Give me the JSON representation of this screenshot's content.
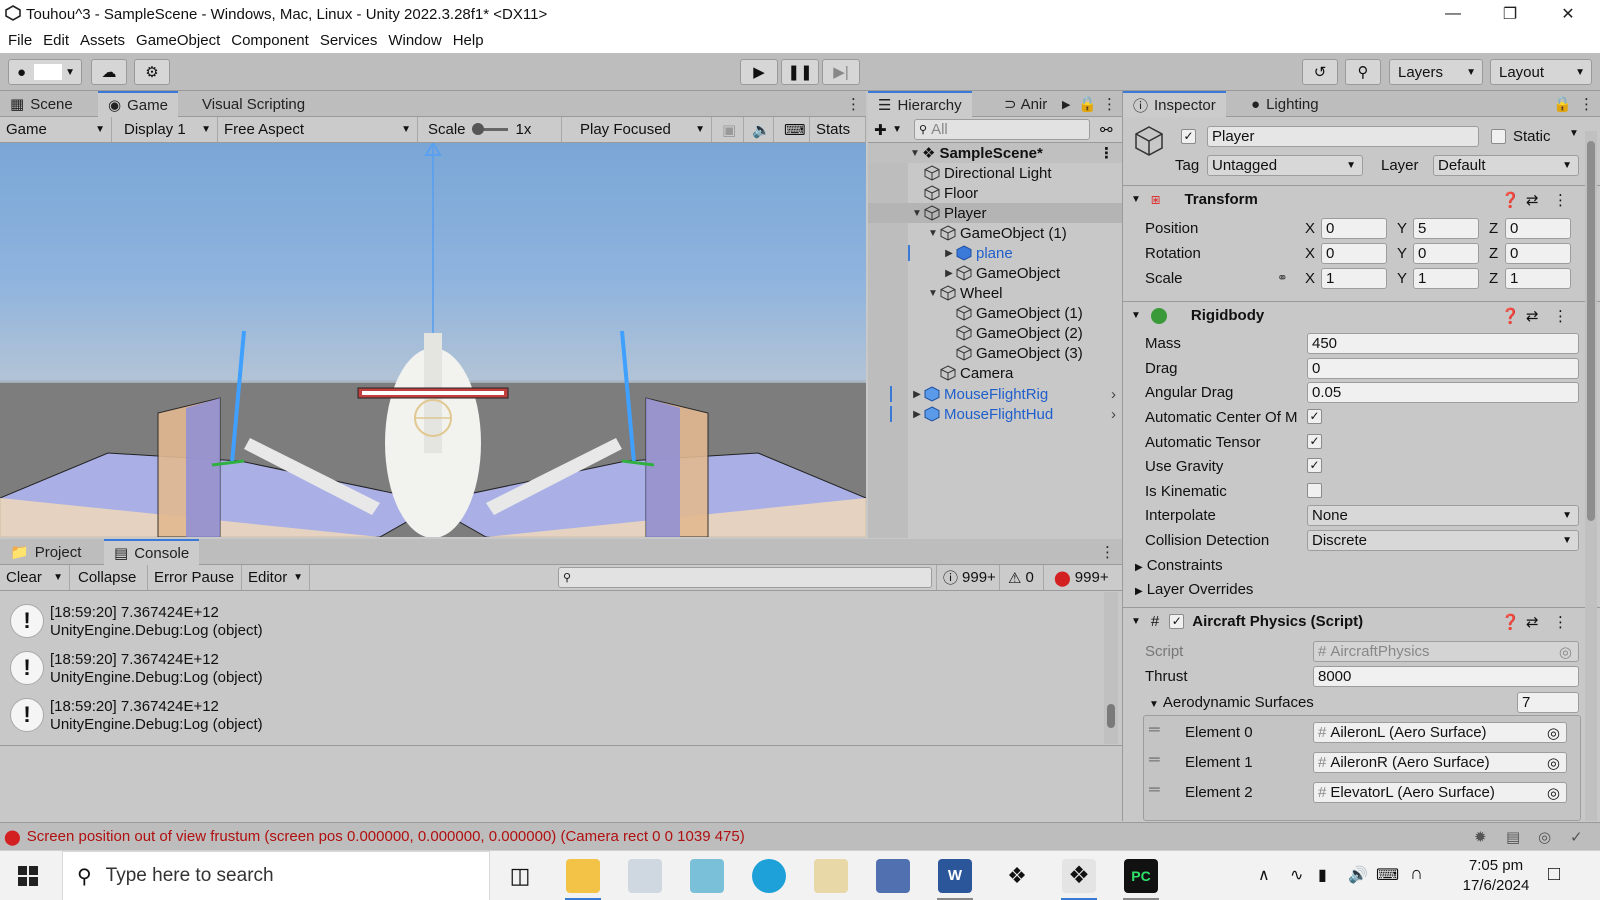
{
  "window": {
    "title": "Touhou^3 - SampleScene - Windows, Mac, Linux - Unity 2022.3.28f1* <DX11>"
  },
  "menu": [
    "File",
    "Edit",
    "Assets",
    "GameObject",
    "Component",
    "Services",
    "Window",
    "Help"
  ],
  "toolbar": {
    "layers_label": "Layers",
    "layout_label": "Layout"
  },
  "game_panel": {
    "tabs": [
      "Scene",
      "Game",
      "Visual Scripting"
    ],
    "controls": {
      "mode": "Game",
      "display": "Display 1",
      "aspect": "Free Aspect",
      "scale_label": "Scale",
      "scale_value": "1x",
      "play_mode": "Play Focused",
      "stats": "Stats"
    }
  },
  "hierarchy": {
    "tabs": [
      "Hierarchy",
      "Anir"
    ],
    "search_placeholder": "All",
    "scene": "SampleScene*",
    "items": [
      "Directional Light",
      "Floor",
      "Player",
      "GameObject (1)",
      "plane",
      "GameObject",
      "Wheel",
      "GameObject (1)",
      "GameObject (2)",
      "GameObject (3)",
      "Camera",
      "MouseFlightRig",
      "MouseFlightHud"
    ]
  },
  "inspector": {
    "tabs": [
      "Inspector",
      "Lighting"
    ],
    "object_name": "Player",
    "static_label": "Static",
    "tag_label": "Tag",
    "tag_value": "Untagged",
    "layer_label": "Layer",
    "layer_value": "Default",
    "transform": {
      "title": "Transform",
      "position_label": "Position",
      "rotation_label": "Rotation",
      "scale_label": "Scale",
      "position": [
        "0",
        "5",
        "0"
      ],
      "rotation": [
        "0",
        "0",
        "0"
      ],
      "scale": [
        "1",
        "1",
        "1"
      ],
      "axes": [
        "X",
        "Y",
        "Z"
      ]
    },
    "rigidbody": {
      "title": "Rigidbody",
      "mass_label": "Mass",
      "mass": "450",
      "drag_label": "Drag",
      "drag": "0",
      "angular_drag_label": "Angular Drag",
      "angular_drag": "0.05",
      "auto_com_label": "Automatic Center Of M",
      "auto_tensor_label": "Automatic Tensor",
      "use_gravity_label": "Use Gravity",
      "is_kinematic_label": "Is Kinematic",
      "interpolate_label": "Interpolate",
      "interpolate": "None",
      "collision_label": "Collision Detection",
      "collision": "Discrete",
      "constraints_label": "Constraints",
      "layer_overrides_label": "Layer Overrides"
    },
    "aircraft": {
      "title": "Aircraft Physics (Script)",
      "script_label": "Script",
      "script_value": "AircraftPhysics",
      "thrust_label": "Thrust",
      "thrust": "8000",
      "aero_label": "Aerodynamic Surfaces",
      "aero_count": "7",
      "elements": [
        {
          "label": "Element 0",
          "value": "AileronL (Aero Surface)"
        },
        {
          "label": "Element 1",
          "value": "AileronR (Aero Surface)"
        },
        {
          "label": "Element 2",
          "value": "ElevatorL (Aero Surface)"
        }
      ]
    }
  },
  "console_panel": {
    "tabs": [
      "Project",
      "Console"
    ],
    "clear": "Clear",
    "collapse": "Collapse",
    "error_pause": "Error Pause",
    "editor": "Editor",
    "count_info": "999+",
    "count_warn": "0",
    "count_error": "999+",
    "logs": [
      {
        "line1": "[18:59:20] 7.367424E+12",
        "line2": "UnityEngine.Debug:Log (object)"
      },
      {
        "line1": "[18:59:20] 7.367424E+12",
        "line2": "UnityEngine.Debug:Log (object)"
      },
      {
        "line1": "[18:59:20] 7.367424E+12",
        "line2": "UnityEngine.Debug:Log (object)"
      }
    ]
  },
  "status": {
    "message": "Screen position out of view frustum (screen pos 0.000000, 0.000000, 0.000000) (Camera rect 0 0 1039 475)"
  },
  "taskbar": {
    "search_placeholder": "Type here to search",
    "time": "7:05 pm",
    "date": "17/6/2024"
  },
  "colors": {
    "accent": "#3a79d6",
    "prefab_blue": "#1f5fcc",
    "error_red": "#d32020",
    "selected_row": "#b4b4b4"
  }
}
